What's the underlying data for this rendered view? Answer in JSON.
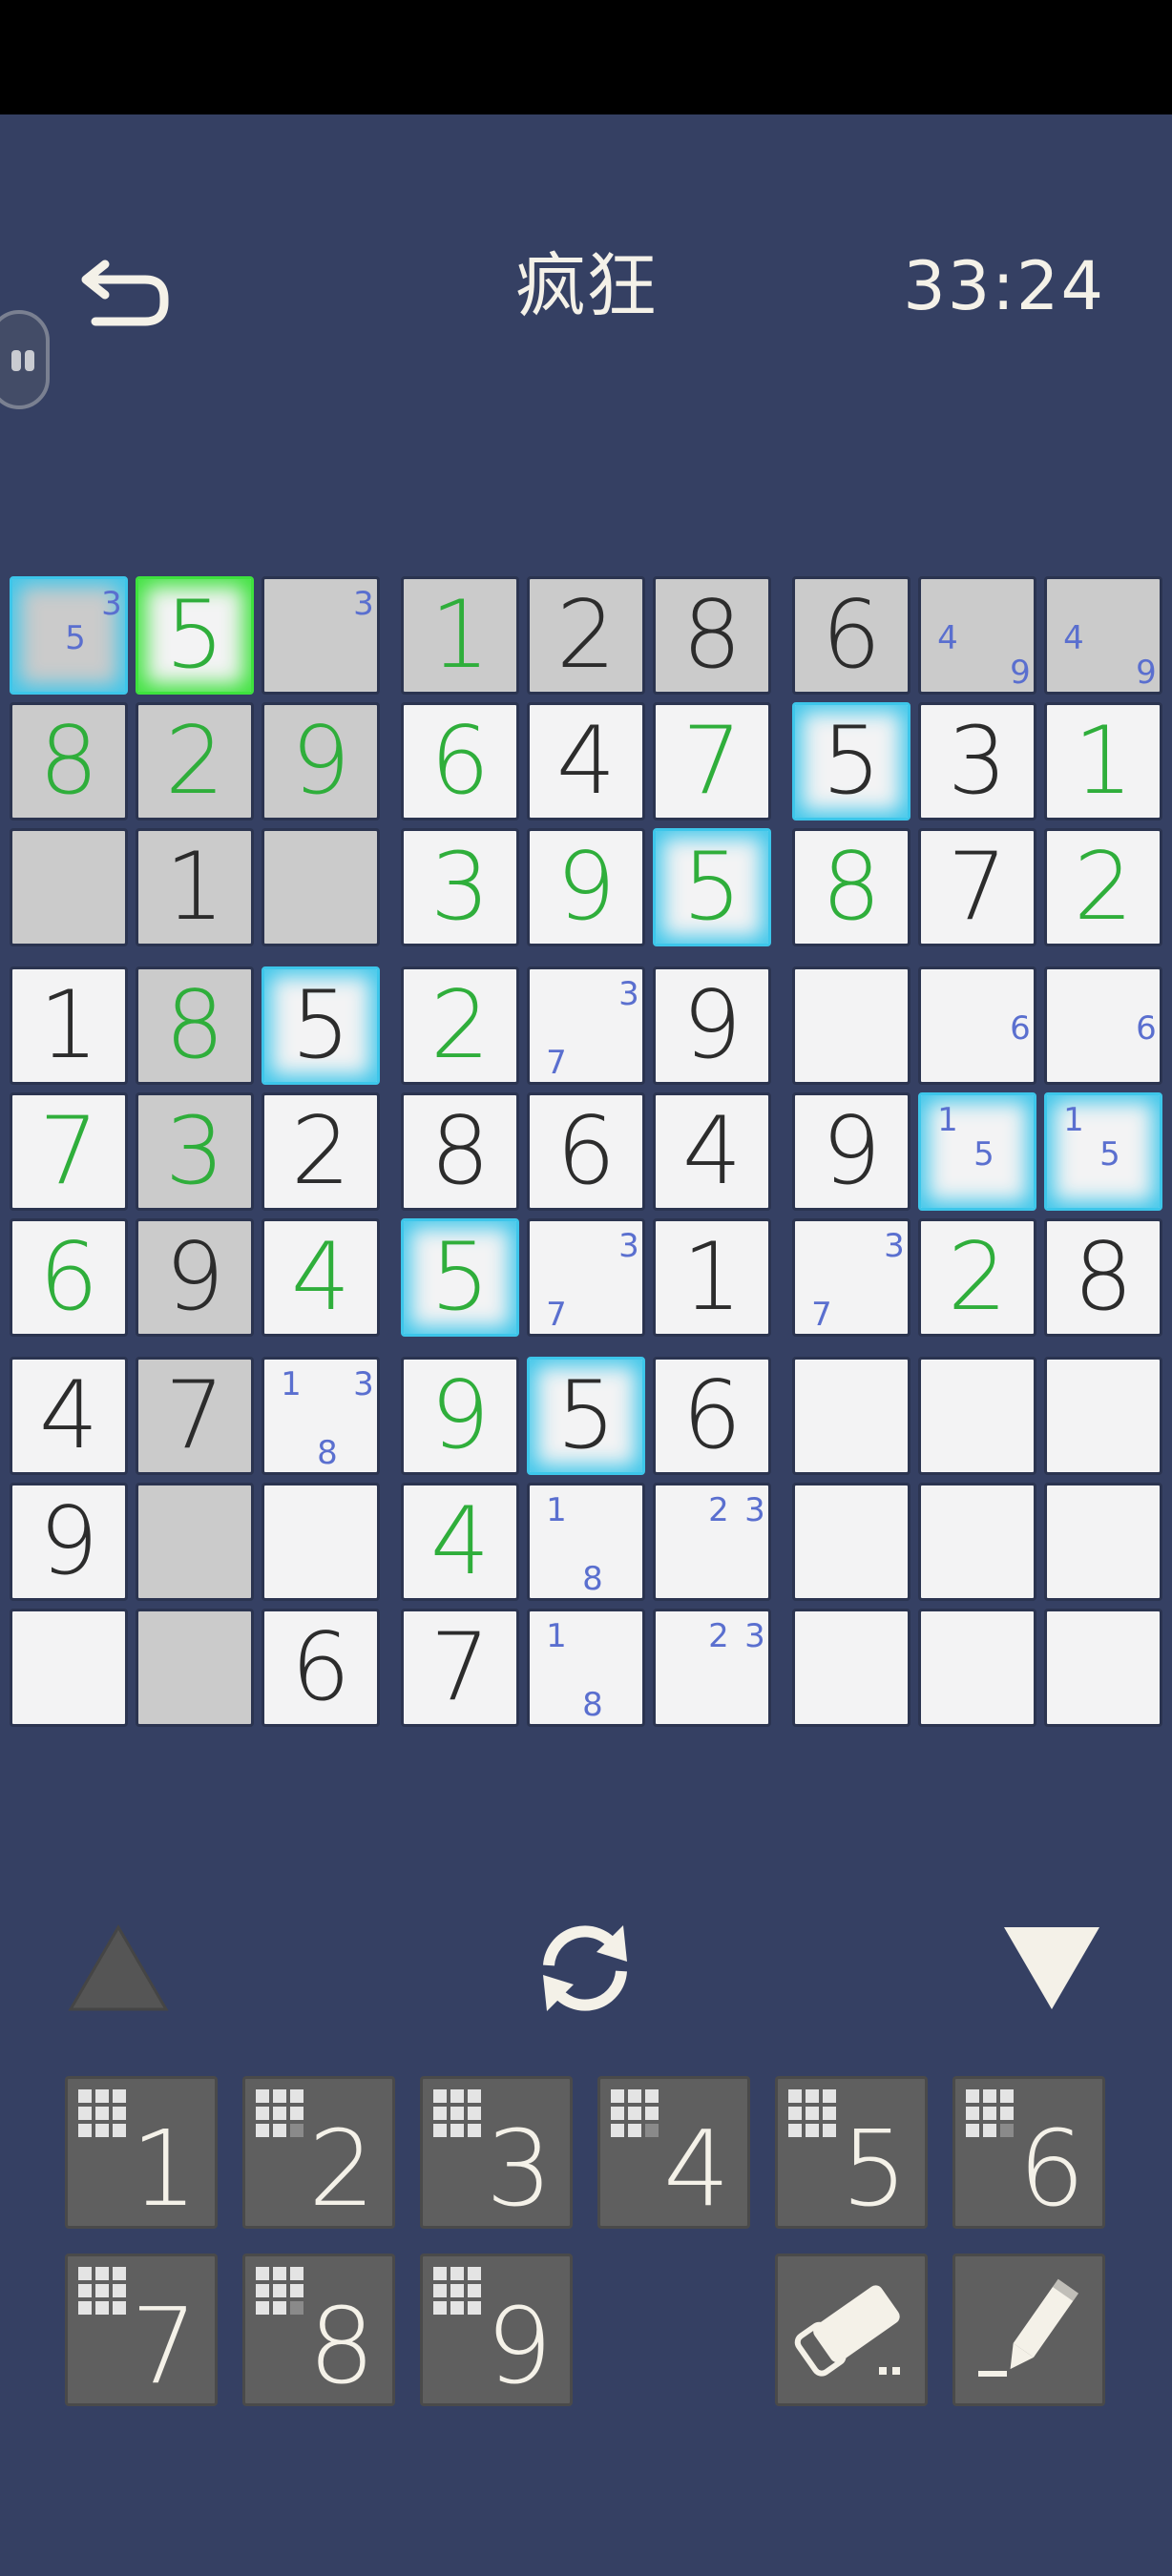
{
  "header": {
    "title": "疯狂",
    "timer": "33:24"
  },
  "board": {
    "cells": [
      [
        {
          "n": [
            3,
            5
          ],
          "bg": "given",
          "hl": "hl"
        },
        {
          "v": "5",
          "st": "entered",
          "bg": "blank",
          "hl": "sel"
        },
        {
          "n": [
            3
          ],
          "bg": "given"
        },
        {
          "v": "1",
          "st": "entered",
          "bg": "given"
        },
        {
          "v": "2",
          "st": "fixed",
          "bg": "given"
        },
        {
          "v": "8",
          "st": "fixed",
          "bg": "given"
        },
        {
          "v": "6",
          "st": "fixed",
          "bg": "given"
        },
        {
          "n": [
            4,
            9
          ],
          "bg": "given"
        },
        {
          "n": [
            4,
            9
          ],
          "bg": "given"
        }
      ],
      [
        {
          "v": "8",
          "st": "entered",
          "bg": "given"
        },
        {
          "v": "2",
          "st": "entered",
          "bg": "given"
        },
        {
          "v": "9",
          "st": "entered",
          "bg": "given"
        },
        {
          "v": "6",
          "st": "entered",
          "bg": "blank"
        },
        {
          "v": "4",
          "st": "fixed",
          "bg": "blank"
        },
        {
          "v": "7",
          "st": "entered",
          "bg": "blank"
        },
        {
          "v": "5",
          "st": "fixed",
          "bg": "blank",
          "hl": "hl"
        },
        {
          "v": "3",
          "st": "fixed",
          "bg": "blank"
        },
        {
          "v": "1",
          "st": "entered",
          "bg": "blank"
        }
      ],
      [
        {
          "bg": "given"
        },
        {
          "v": "1",
          "st": "fixed",
          "bg": "given"
        },
        {
          "bg": "given"
        },
        {
          "v": "3",
          "st": "entered",
          "bg": "blank"
        },
        {
          "v": "9",
          "st": "entered",
          "bg": "blank"
        },
        {
          "v": "5",
          "st": "entered",
          "bg": "blank",
          "hl": "hl"
        },
        {
          "v": "8",
          "st": "entered",
          "bg": "blank"
        },
        {
          "v": "7",
          "st": "fixed",
          "bg": "blank"
        },
        {
          "v": "2",
          "st": "entered",
          "bg": "blank"
        }
      ],
      [
        {
          "v": "1",
          "st": "fixed",
          "bg": "blank"
        },
        {
          "v": "8",
          "st": "entered",
          "bg": "given"
        },
        {
          "v": "5",
          "st": "fixed",
          "bg": "blank",
          "hl": "hl"
        },
        {
          "v": "2",
          "st": "entered",
          "bg": "blank"
        },
        {
          "n": [
            3,
            7
          ],
          "bg": "blank"
        },
        {
          "v": "9",
          "st": "fixed",
          "bg": "blank"
        },
        {
          "bg": "blank"
        },
        {
          "n": [
            6
          ],
          "bg": "blank"
        },
        {
          "n": [
            6
          ],
          "bg": "blank"
        }
      ],
      [
        {
          "v": "7",
          "st": "entered",
          "bg": "blank"
        },
        {
          "v": "3",
          "st": "entered",
          "bg": "given"
        },
        {
          "v": "2",
          "st": "fixed",
          "bg": "blank"
        },
        {
          "v": "8",
          "st": "fixed",
          "bg": "blank"
        },
        {
          "v": "6",
          "st": "fixed",
          "bg": "blank"
        },
        {
          "v": "4",
          "st": "fixed",
          "bg": "blank"
        },
        {
          "v": "9",
          "st": "fixed",
          "bg": "blank"
        },
        {
          "n": [
            1,
            5
          ],
          "bg": "blank",
          "hl": "hl"
        },
        {
          "n": [
            1,
            5
          ],
          "bg": "blank",
          "hl": "hl"
        }
      ],
      [
        {
          "v": "6",
          "st": "entered",
          "bg": "blank"
        },
        {
          "v": "9",
          "st": "fixed",
          "bg": "given"
        },
        {
          "v": "4",
          "st": "entered",
          "bg": "blank"
        },
        {
          "v": "5",
          "st": "entered",
          "bg": "blank",
          "hl": "hl"
        },
        {
          "n": [
            3,
            7
          ],
          "bg": "blank"
        },
        {
          "v": "1",
          "st": "fixed",
          "bg": "blank"
        },
        {
          "n": [
            3,
            7
          ],
          "bg": "blank"
        },
        {
          "v": "2",
          "st": "entered",
          "bg": "blank"
        },
        {
          "v": "8",
          "st": "fixed",
          "bg": "blank"
        }
      ],
      [
        {
          "v": "4",
          "st": "fixed",
          "bg": "blank"
        },
        {
          "v": "7",
          "st": "fixed",
          "bg": "given"
        },
        {
          "n": [
            1,
            3,
            8
          ],
          "bg": "blank"
        },
        {
          "v": "9",
          "st": "entered",
          "bg": "blank"
        },
        {
          "v": "5",
          "st": "fixed",
          "bg": "blank",
          "hl": "hl"
        },
        {
          "v": "6",
          "st": "fixed",
          "bg": "blank"
        },
        {
          "bg": "blank"
        },
        {
          "bg": "blank"
        },
        {
          "bg": "blank"
        }
      ],
      [
        {
          "v": "9",
          "st": "fixed",
          "bg": "blank"
        },
        {
          "bg": "given"
        },
        {
          "bg": "blank"
        },
        {
          "v": "4",
          "st": "entered",
          "bg": "blank"
        },
        {
          "n": [
            1,
            8
          ],
          "bg": "blank"
        },
        {
          "n": [
            2,
            3
          ],
          "bg": "blank"
        },
        {
          "bg": "blank"
        },
        {
          "bg": "blank"
        },
        {
          "bg": "blank"
        }
      ],
      [
        {
          "bg": "blank"
        },
        {
          "bg": "given"
        },
        {
          "v": "6",
          "st": "fixed",
          "bg": "blank"
        },
        {
          "v": "7",
          "st": "fixed",
          "bg": "blank"
        },
        {
          "n": [
            1,
            8
          ],
          "bg": "blank"
        },
        {
          "n": [
            2,
            3
          ],
          "bg": "blank"
        },
        {
          "bg": "blank"
        },
        {
          "bg": "blank"
        },
        {
          "bg": "blank"
        }
      ]
    ]
  },
  "keypad": {
    "digits": [
      "1",
      "2",
      "3",
      "4",
      "5",
      "6",
      "7",
      "8",
      "9"
    ],
    "eraser_icon": "eraser-icon",
    "pencil_icon": "pencil-icon"
  },
  "toolbar": {
    "up_icon": "triangle-up-icon",
    "swap_icon": "refresh-icon",
    "down_icon": "triangle-down-icon"
  },
  "colors": {
    "background": "#354063",
    "entered_digit": "#2fae3b",
    "fixed_digit": "#2c2c2c",
    "note": "#5a6fcf",
    "highlight": "#3dc6ea",
    "selected": "#3ee23e",
    "key": "#5f5f5f"
  }
}
